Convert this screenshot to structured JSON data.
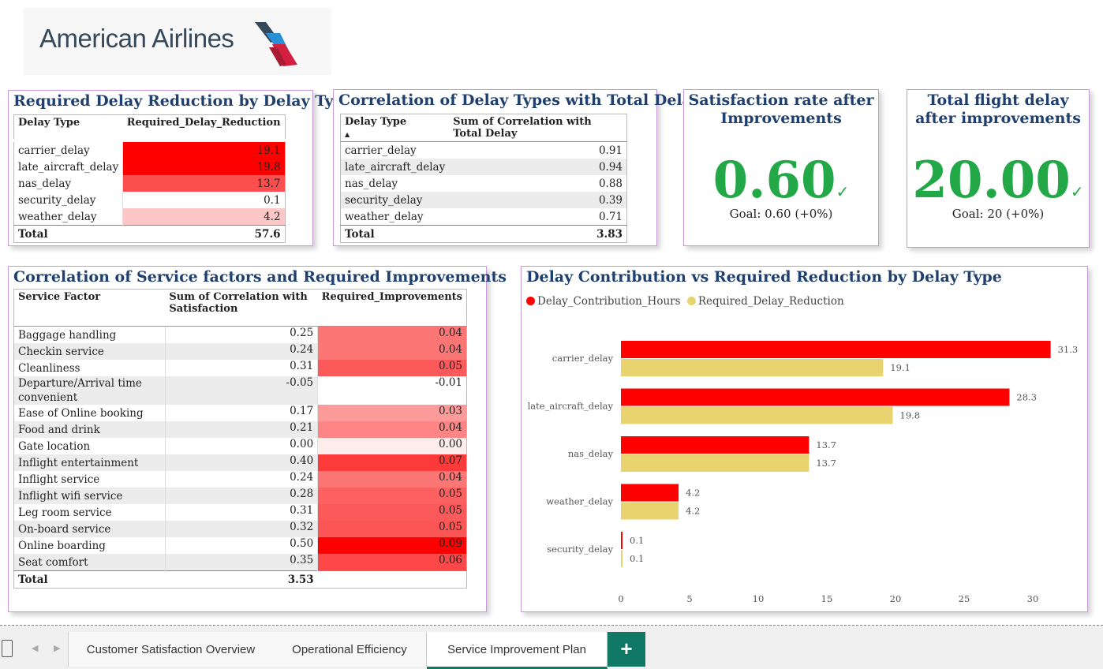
{
  "brand": {
    "name": "American Airlines"
  },
  "delay_reduction": {
    "title": "Required Delay Reduction by Delay Type",
    "headers": [
      "Delay Type",
      "Required_Delay_Reduction"
    ],
    "rows": [
      {
        "type": "carrier_delay",
        "value": "19.1",
        "heat": "#ff0000"
      },
      {
        "type": "late_aircraft_delay",
        "value": "19.8",
        "heat": "#ff0000"
      },
      {
        "type": "nas_delay",
        "value": "13.7",
        "heat": "#fb4e4e"
      },
      {
        "type": "security_delay",
        "value": "0.1",
        "heat": "#ffffff"
      },
      {
        "type": "weather_delay",
        "value": "4.2",
        "heat": "#fdc7c7"
      }
    ],
    "total_label": "Total",
    "total_value": "57.6"
  },
  "delay_correlation": {
    "title": "Correlation of Delay Types with Total Delay",
    "headers": [
      "Delay Type",
      "Sum of Correlation with Total Delay"
    ],
    "rows": [
      {
        "type": "carrier_delay",
        "value": "0.91"
      },
      {
        "type": "late_aircraft_delay",
        "value": "0.94"
      },
      {
        "type": "nas_delay",
        "value": "0.88"
      },
      {
        "type": "security_delay",
        "value": "0.39"
      },
      {
        "type": "weather_delay",
        "value": "0.71"
      }
    ],
    "total_label": "Total",
    "total_value": "3.83"
  },
  "kpi_satisfaction": {
    "title": "Satisfaction rate after Improvements",
    "value": "0.60",
    "check": "✓",
    "goal": "Goal: 0.60 (+0%)"
  },
  "kpi_delay": {
    "title": "Total flight delay after improvements",
    "value": "20.00",
    "check": "✓",
    "goal": "Goal: 20 (+0%)"
  },
  "service": {
    "title": "Correlation of Service factors and Required Improvements",
    "headers": [
      "Service Factor",
      "Sum of Correlation with Satisfaction",
      "Required_Improvements"
    ],
    "rows": [
      {
        "factor": "Baggage handling",
        "corr": "0.25",
        "imp": "0.04",
        "heat": "#fd7676"
      },
      {
        "factor": "Checkin service",
        "corr": "0.24",
        "imp": "0.04",
        "heat": "#fd7676"
      },
      {
        "factor": "Cleanliness",
        "corr": "0.31",
        "imp": "0.05",
        "heat": "#fc5a5a"
      },
      {
        "factor": "Departure/Arrival time convenient",
        "corr": "-0.05",
        "imp": "-0.01",
        "heat": "#ffffff"
      },
      {
        "factor": "Ease of Online booking",
        "corr": "0.17",
        "imp": "0.03",
        "heat": "#fd9b9b"
      },
      {
        "factor": "Food and drink",
        "corr": "0.21",
        "imp": "0.04",
        "heat": "#fd8585"
      },
      {
        "factor": "Gate location",
        "corr": "0.00",
        "imp": "0.00",
        "heat": "#fdecec"
      },
      {
        "factor": "Inflight entertainment",
        "corr": "0.40",
        "imp": "0.07",
        "heat": "#fc3a3a"
      },
      {
        "factor": "Inflight service",
        "corr": "0.24",
        "imp": "0.04",
        "heat": "#fd7676"
      },
      {
        "factor": "Inflight wifi service",
        "corr": "0.28",
        "imp": "0.05",
        "heat": "#fc6060"
      },
      {
        "factor": "Leg room service",
        "corr": "0.31",
        "imp": "0.05",
        "heat": "#fc5a5a"
      },
      {
        "factor": "On-board service",
        "corr": "0.32",
        "imp": "0.05",
        "heat": "#fc5555"
      },
      {
        "factor": "Online boarding",
        "corr": "0.50",
        "imp": "0.09",
        "heat": "#ff0000"
      },
      {
        "factor": "Seat comfort",
        "corr": "0.35",
        "imp": "0.06",
        "heat": "#fc4848"
      }
    ],
    "total_label": "Total",
    "total_value": "3.53"
  },
  "bar_chart": {
    "title": "Delay Contribution vs Required Reduction by Delay Type"
  },
  "chart_data": {
    "type": "bar",
    "orientation": "horizontal",
    "title": "Delay Contribution vs Required Reduction by Delay Type",
    "categories": [
      "carrier_delay",
      "late_aircraft_delay",
      "nas_delay",
      "weather_delay",
      "security_delay"
    ],
    "series": [
      {
        "name": "Delay_Contribution_Hours",
        "color": "#ff0000",
        "values": [
          31.3,
          28.3,
          13.7,
          4.2,
          0.1
        ]
      },
      {
        "name": "Required_Delay_Reduction",
        "color": "#e8d36e",
        "values": [
          19.1,
          19.8,
          13.7,
          4.2,
          0.1
        ]
      }
    ],
    "xlim": [
      0,
      32
    ],
    "xticks": [
      0,
      5,
      10,
      15,
      20,
      25,
      30
    ],
    "legend": "top-left",
    "grid": false
  },
  "tabs": [
    {
      "label": "Customer Satisfaction Overview"
    },
    {
      "label": "Operational Efficiency"
    },
    {
      "label": "Service Improvement Plan"
    }
  ],
  "add_tab_label": "+"
}
